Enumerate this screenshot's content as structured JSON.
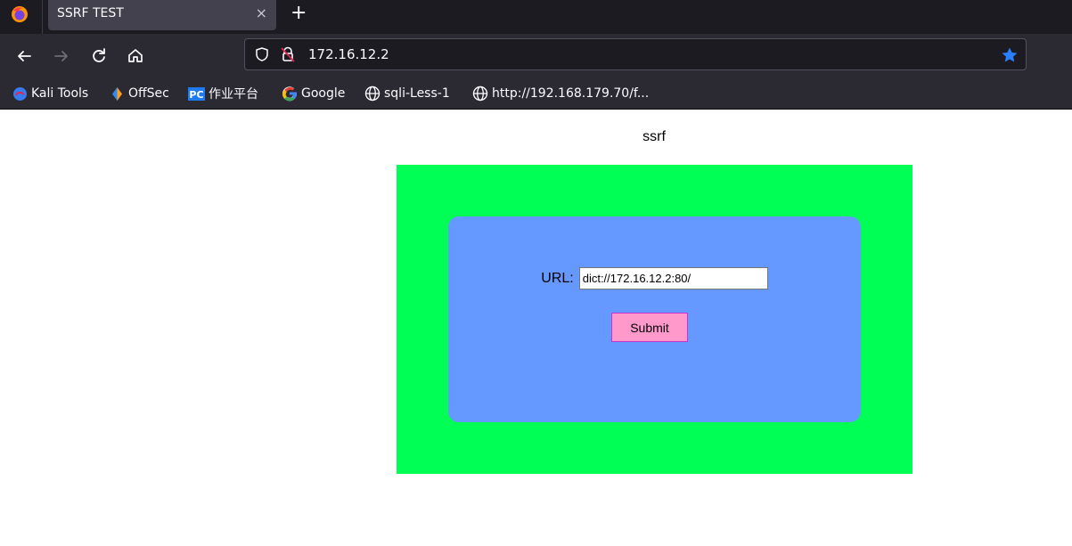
{
  "browser": {
    "tab_title": "SSRF TEST",
    "tab_close": "×",
    "new_tab": "+",
    "url": "172.16.12.2",
    "bookmarks": [
      {
        "label": "Kali Tools",
        "icon": "kali-icon"
      },
      {
        "label": "OffSec",
        "icon": "offsec-icon"
      },
      {
        "label": "作业平台",
        "icon": "pycharm-icon"
      },
      {
        "label": "Google",
        "icon": "google-icon"
      },
      {
        "label": "sqli-Less-1",
        "icon": "globe-icon"
      },
      {
        "label": "http://192.168.179.70/f...",
        "icon": "globe-icon"
      }
    ]
  },
  "page": {
    "heading": "ssrf",
    "form": {
      "url_label": "URL:",
      "url_value": "dict://172.16.12.2:80/",
      "submit_label": "Submit"
    }
  },
  "colors": {
    "outer_box": "#00ff55",
    "inner_box": "#6699ff",
    "submit_button": "#ff99cc"
  }
}
